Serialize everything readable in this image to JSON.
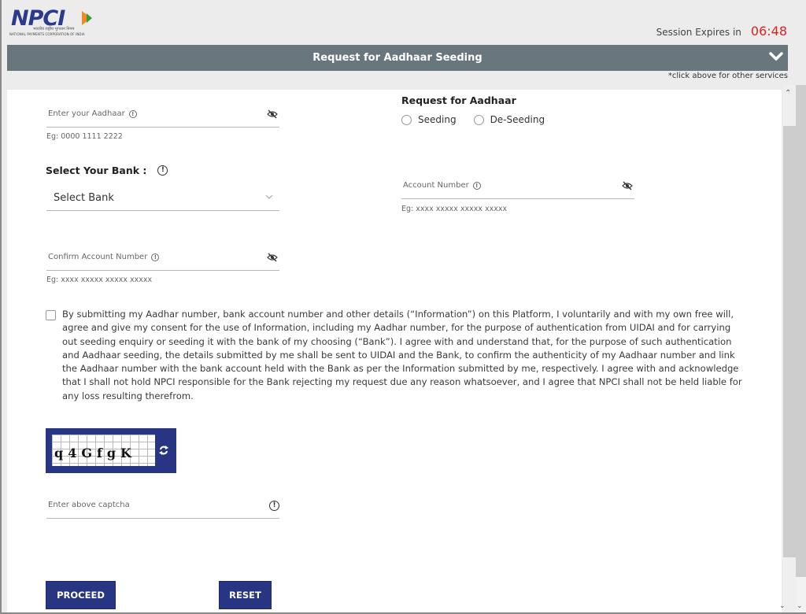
{
  "header": {
    "logo_text": "NPCI",
    "logo_hindi": "भारतीय राष्ट्रीय भुगतान निगम",
    "logo_subtitle": "NATIONAL PAYMENTS CORPORATION OF INDIA",
    "session_label": "Session Expires in",
    "session_time": "06:48",
    "session_color": "#e02020"
  },
  "service_bar": {
    "title": "Request for Aadhaar Seeding",
    "hint": "*click above for other services",
    "color": "#69767d"
  },
  "form": {
    "aadhaar": {
      "label": "Enter your Aadhaar",
      "value": "",
      "hint": "Eg: 0000 1111 2222"
    },
    "request_type": {
      "title": "Request for Aadhaar",
      "options": [
        {
          "label": "Seeding",
          "selected": false
        },
        {
          "label": "De-Seeding",
          "selected": false
        }
      ]
    },
    "bank": {
      "title": "Select Your Bank :",
      "selected": "Select Bank"
    },
    "account_number": {
      "label": "Account Number",
      "value": "",
      "hint": "Eg: xxxx xxxxx xxxxx xxxxx"
    },
    "confirm_account_number": {
      "label": "Confirm Account Number",
      "value": "",
      "hint": "Eg: xxxx xxxxx xxxxx xxxxx"
    },
    "consent": {
      "checked": false,
      "text": "By submitting my Aadhar number, bank account number and other details (“Information”) on this Platform, I voluntarily and with my own free will, agree and give my consent for the use of Information, including my Aadhar number, for the purpose of authentication from UIDAI and for carrying out seeding enquiry or seeding it with the bank of my choosing (“Bank”). I agree with and understand that, for the purpose of such authentication and Aadhaar seeding, the details submitted by me shall be sent to UIDAI and the Bank, to confirm the authenticity of my Aadhaar number and link the Aadhaar number with the bank account held with the Bank as per the Information submitted by me, respectively. I agree with and acknowledge that I shall not hold NPCI responsible for the Bank rejecting my request due any reason whatsoever, and I agree that NPCI shall not be held liable for any loss resulting therefrom."
    },
    "captcha": {
      "image_text": "q4GfgK",
      "input_label": "Enter above captcha",
      "value": ""
    },
    "buttons": {
      "proceed": "PROCEED",
      "reset": "RESET",
      "color": "#283583"
    }
  },
  "icons": {
    "info": "!",
    "scroll_up": "⌃",
    "scroll_down": "⌄"
  }
}
